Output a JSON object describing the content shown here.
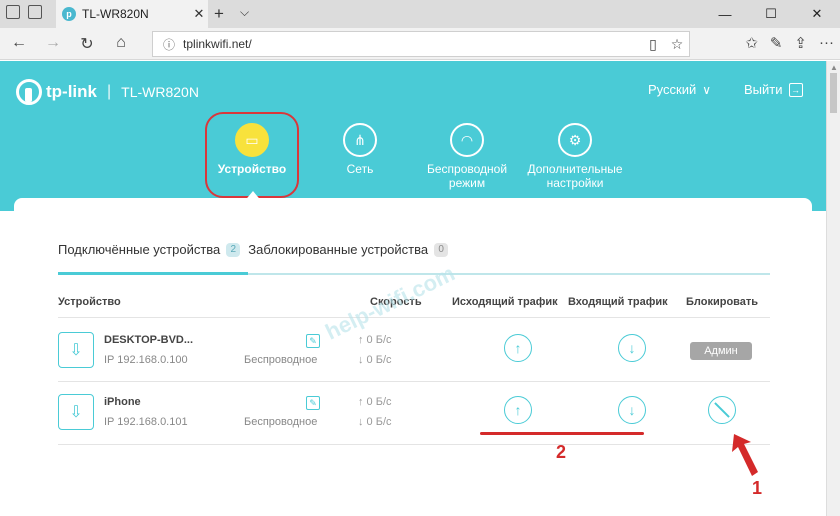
{
  "browser": {
    "tab_title": "TL-WR820N",
    "tab_close": "✕",
    "new_tab": "+",
    "tab_dropdown": "⌵",
    "url": "tplinkwifi.net/",
    "win_minimize": "—",
    "win_maximize": "☐",
    "win_close": "✕"
  },
  "header": {
    "brand": "tp-link",
    "separator": "|",
    "model": "TL-WR820N",
    "language": "Русский",
    "logout": "Выйти"
  },
  "menu": [
    {
      "label": "Устройство",
      "icon": "monitor-icon"
    },
    {
      "label": "Сеть",
      "icon": "network-icon"
    },
    {
      "label": "Беспроводной режим",
      "icon": "wifi-icon"
    },
    {
      "label": "Дополнительные настройки",
      "icon": "gear-icon"
    }
  ],
  "tabs": {
    "connected_label": "Подключённые устройства",
    "connected_count": "2",
    "blocked_label": "Заблокированные устройства",
    "blocked_count": "0"
  },
  "table": {
    "headers": {
      "device": "Устройство",
      "speed": "Скорость",
      "upload": "Исходящий трафик",
      "download": "Входящий трафик",
      "block": "Блокировать"
    },
    "rows": [
      {
        "name": "DESKTOP-BVD...",
        "ip": "IP 192.168.0.100",
        "connection": "Беспроводное",
        "up_speed": "↑ 0 Б/с",
        "down_speed": "↓ 0 Б/с",
        "block": "Админ"
      },
      {
        "name": "iPhone",
        "ip": "IP 192.168.0.101",
        "connection": "Беспроводное",
        "up_speed": "↑ 0 Б/с",
        "down_speed": "↓ 0 Б/с",
        "block": ""
      }
    ]
  },
  "watermark": "help-wifi.com",
  "annotations": {
    "label_1": "1",
    "label_2": "2"
  },
  "colors": {
    "accent": "#4acbd6",
    "active_menu": "#f8e23c",
    "annotation": "#d42a2a"
  }
}
